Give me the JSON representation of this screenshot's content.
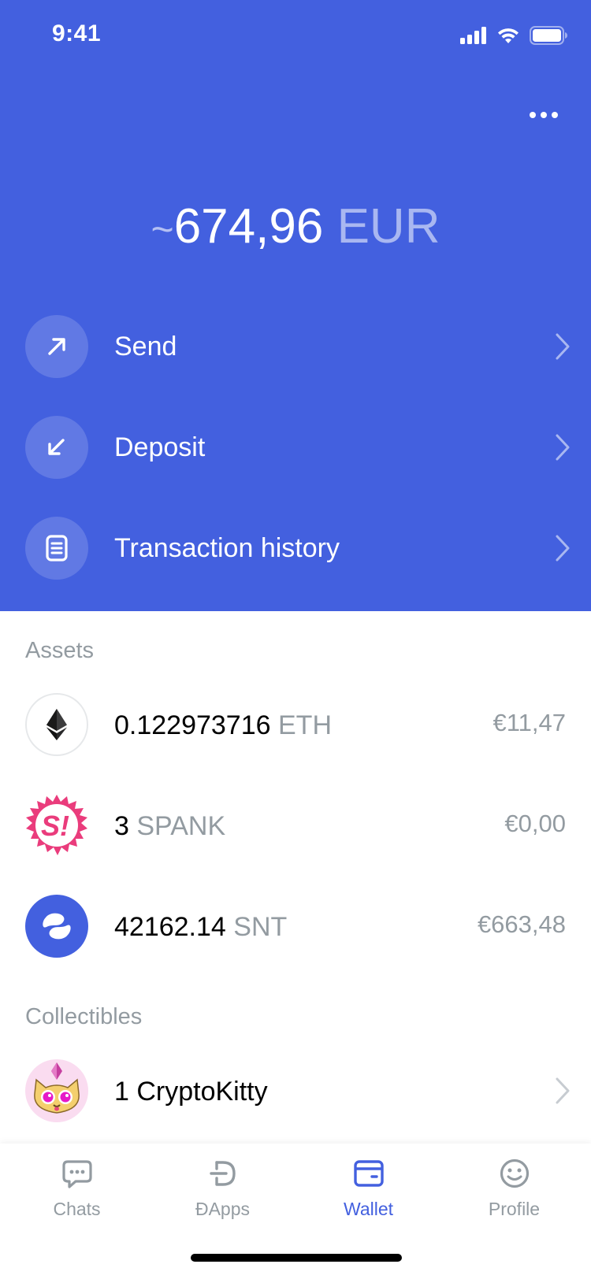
{
  "status_bar": {
    "time": "9:41"
  },
  "header": {
    "balance_prefix": "~",
    "balance_value": "674,96",
    "balance_currency": "EUR",
    "actions": [
      {
        "label": "Send",
        "icon": "arrow-up-right-icon"
      },
      {
        "label": "Deposit",
        "icon": "arrow-down-left-icon"
      },
      {
        "label": "Transaction history",
        "icon": "document-list-icon"
      }
    ]
  },
  "assets": {
    "title": "Assets",
    "items": [
      {
        "amount": "0.122973716",
        "symbol": "ETH",
        "fiat": "€11,47",
        "icon": "ethereum-icon"
      },
      {
        "amount": "3",
        "symbol": "SPANK",
        "fiat": "€0,00",
        "icon": "spank-icon"
      },
      {
        "amount": "42162.14",
        "symbol": "SNT",
        "fiat": "€663,48",
        "icon": "snt-icon"
      }
    ]
  },
  "collectibles": {
    "title": "Collectibles",
    "items": [
      {
        "label": "1 CryptoKitty",
        "icon": "cryptokitty-icon"
      }
    ]
  },
  "tabbar": {
    "tabs": [
      {
        "label": "Chats",
        "icon": "chat-icon",
        "active": false
      },
      {
        "label": "ÐApps",
        "icon": "dapps-icon",
        "active": false
      },
      {
        "label": "Wallet",
        "icon": "wallet-icon",
        "active": true
      },
      {
        "label": "Profile",
        "icon": "smile-icon",
        "active": false
      }
    ]
  },
  "colors": {
    "accent": "#4360df",
    "gray_text": "#939ba1",
    "spank": "#ea3c7c"
  }
}
